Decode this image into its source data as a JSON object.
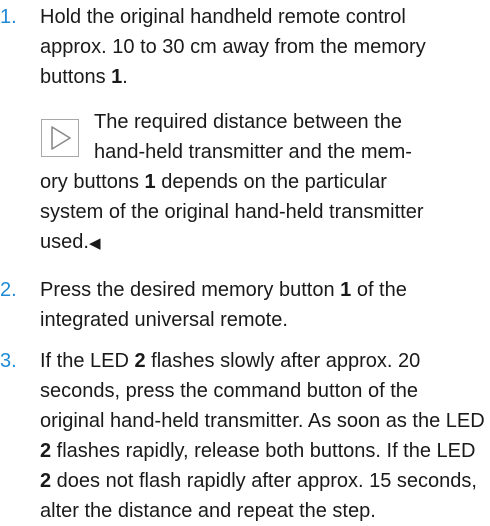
{
  "steps": [
    {
      "number": "1.",
      "line1": "Hold the original handheld remote control",
      "line2": "approx. 10 to 30 cm away from the memory",
      "line3_pre": "buttons ",
      "line3_bold": "1",
      "line3_post": "."
    },
    {
      "number": "2.",
      "text_pre": "Press the desired memory button ",
      "bold": "1",
      "text_post": " of the integrated universal remote."
    },
    {
      "number": "3.",
      "text_a": "If the LED ",
      "bold_a": "2",
      "text_b": " flashes slowly after approx. 20 seconds, press the command button of the original hand-held transmitter. As soon as the LED ",
      "bold_b": "2",
      "text_c": " flashes rapidly, release both buttons. If the LED ",
      "bold_c": "2",
      "text_d": " does not flash rapidly after approx. 15 seconds, alter the distance and repeat the step."
    }
  ],
  "note": {
    "icon": "note-triangle-icon",
    "line1": "The required distance between the",
    "line2": "hand-held transmitter and the mem-",
    "line3_pre": "ory buttons ",
    "line3_bold": "1",
    "line3_post": " depends on the particular",
    "line4": "system of the original hand-held transmitter",
    "line5": "used.",
    "end_mark": "◀"
  },
  "colors": {
    "step_number": "#1f8ad6",
    "icon_border": "#a8a8a8",
    "text": "#1a1a1a"
  }
}
